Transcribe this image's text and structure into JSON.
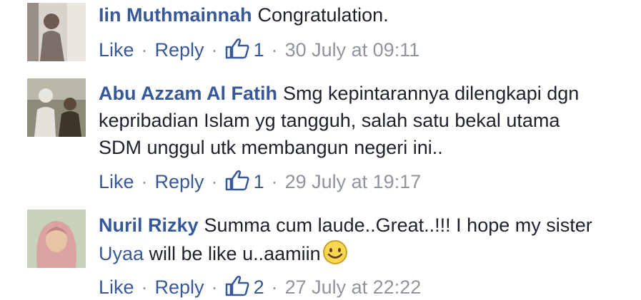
{
  "comments": [
    {
      "author": "Iin Muthmainnah",
      "text": "Congratulation.",
      "like_label": "Like",
      "reply_label": "Reply",
      "like_count": "1",
      "timestamp": "30 July at 09:11"
    },
    {
      "author": "Abu Azzam Al Fatih",
      "text": "Smg kepintarannya dilengkapi dgn kepribadian Islam yg tangguh, salah satu bekal utama SDM unggul utk membangun negeri ini..",
      "like_label": "Like",
      "reply_label": "Reply",
      "like_count": "1",
      "timestamp": "29 July at 19:17"
    },
    {
      "author": "Nuril Rizky",
      "text_before_mention": "Summa cum laude..Great..!!! I hope my sister ",
      "mention": "Uyaa",
      "text_after_mention": " will be like u..aamiin",
      "like_label": "Like",
      "reply_label": "Reply",
      "like_count": "2",
      "timestamp": "27 July at 22:22"
    }
  ],
  "separator": "·",
  "colors": {
    "link": "#365899",
    "meta": "#90949c",
    "text": "#1d2129"
  },
  "icons": [
    "thumbs-up-icon",
    "smiley-emoji-icon"
  ]
}
